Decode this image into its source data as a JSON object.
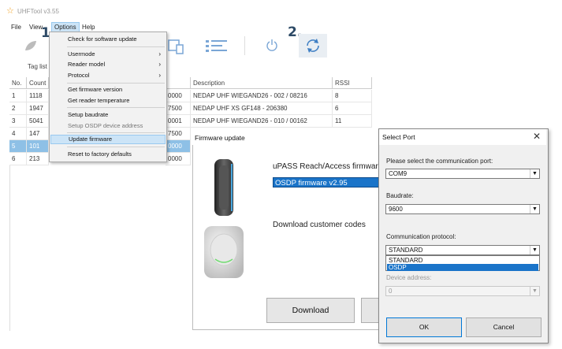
{
  "app": {
    "title": "UHFTool v3.55"
  },
  "menubar": {
    "file": "File",
    "view": "View",
    "options": "Options",
    "help": "Help"
  },
  "steps": {
    "one": "1.",
    "two": "2."
  },
  "tabs": {
    "tag_list": "Tag list"
  },
  "table": {
    "headers": [
      "No.",
      "Count",
      "",
      "Description",
      "RSSI"
    ],
    "rows": [
      {
        "no": "1",
        "count": "1118",
        "id": "0000",
        "description": "NEDAP UHF WIEGAND26 - 002 / 08216",
        "rssi": "8"
      },
      {
        "no": "2",
        "count": "1947",
        "id": "7500",
        "description": "NEDAP UHF XS GF148 - 206380",
        "rssi": "6"
      },
      {
        "no": "3",
        "count": "5041",
        "id": "0001",
        "description": "NEDAP UHF WIEGAND26 - 010 / 00162",
        "rssi": "11"
      },
      {
        "no": "4",
        "count": "147",
        "id": "7500",
        "description": "",
        "rssi": ""
      },
      {
        "no": "5",
        "count": "101",
        "id": "0000",
        "description": "",
        "rssi": ""
      },
      {
        "no": "6",
        "count": "213",
        "id": "0000",
        "description": "",
        "rssi": ""
      }
    ]
  },
  "options_menu": {
    "items": [
      {
        "label": "Check for software update"
      },
      {
        "label": "Usermode",
        "submenu": true
      },
      {
        "label": "Reader model",
        "submenu": true
      },
      {
        "label": "Protocol",
        "submenu": true
      },
      {
        "label": "Get firmware version"
      },
      {
        "label": "Get reader temperature"
      },
      {
        "label": "Setup baudrate"
      },
      {
        "label": "Setup OSDP device address",
        "disabled": true
      },
      {
        "label": "Update firmware",
        "highlighted": true
      },
      {
        "label": "Reset to factory defaults"
      }
    ]
  },
  "firmware_window": {
    "title": "Firmware update",
    "product": "uPASS Reach/Access firmware",
    "selected_firmware": "OSDP firmware v2.95",
    "customer_codes": "Download customer codes",
    "download_button": "Download"
  },
  "select_port": {
    "title": "Select Port",
    "port_label": "Please select the communication port:",
    "port_value": "COM9",
    "baud_label": "Baudrate:",
    "baud_value": "9600",
    "protocol_label": "Communication protocol:",
    "protocol_value": "STANDARD",
    "protocol_options": [
      "STANDARD",
      "OSDP"
    ],
    "device_address_label": "Device address:",
    "device_address_value": "0",
    "ok": "OK",
    "cancel": "Cancel"
  },
  "colors": {
    "accent": "#1a74c9",
    "selection_row": "#8ec0e6",
    "menu_highlight": "#cce4f7",
    "step_label": "#2d4a66"
  }
}
